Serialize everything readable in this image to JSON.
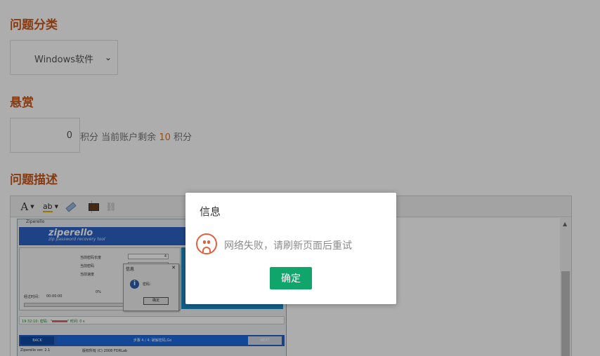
{
  "form": {
    "category_title": "问题分类",
    "category_value": "Windows软件",
    "reward_title": "悬赏",
    "reward_value": "0",
    "reward_unit": "积分",
    "reward_balance_prefix": "当前账户剩余",
    "reward_balance": "10",
    "reward_balance_unit": "积分",
    "description_title": "问题描述"
  },
  "toolbar": {
    "font_label": "A",
    "highlight_label": "ab"
  },
  "embedded": {
    "window_title": "Ziperello",
    "brand": "ziperello",
    "subtitle": "zip password recovery tool",
    "row1_label": "当前密码长度",
    "row1_value": "4",
    "row2_label": "当前密码",
    "row3_label": "当前速度",
    "elapsed_label": "经过时间：",
    "elapsed_value": "00:00:00",
    "progress_text": "0%",
    "dialog_title": "信息",
    "dialog_msg": "密码：",
    "dialog_ok": "确定",
    "log_text": "19:32:10: 密码：\"",
    "log_suffix": "\" 时间: 0 s",
    "back": "BACK",
    "step": "步骤 4 / 4: 破解密码,Go",
    "next": "NEXT",
    "version": "Ziperello ver. 2.1",
    "copyright": "版权所有 (C) 2008 FDRLab"
  },
  "modal": {
    "title": "信息",
    "message": "网络失败，请刷新页面后重试",
    "ok_label": "确定",
    "icon": "sad-face-icon"
  },
  "colors": {
    "section_title": "#c9581a",
    "ok_button": "#0fa56b",
    "sad_icon": "#e0613e"
  }
}
